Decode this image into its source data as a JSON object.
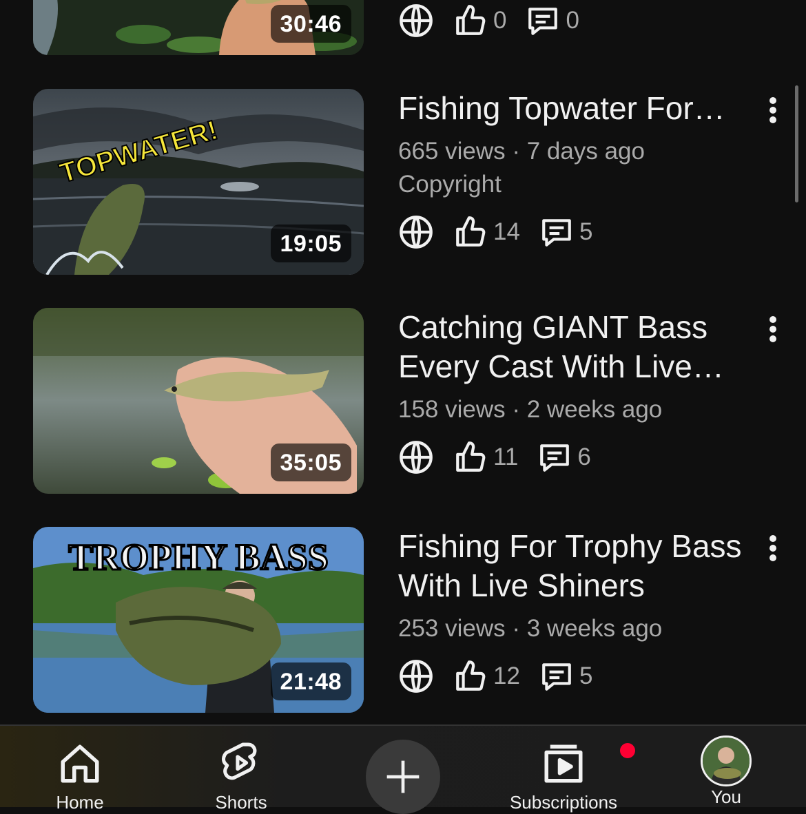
{
  "videos": [
    {
      "duration": "30:46",
      "visibility_icon": "globe-icon",
      "likes": "0",
      "comments": "0"
    },
    {
      "title": "Fishing Topwater For…",
      "meta": "665 views · 7 days ago",
      "claim": "Copyright",
      "duration": "19:05",
      "thumb_text": "TOPWATER!",
      "likes": "14",
      "comments": "5"
    },
    {
      "title": "Catching GIANT Bass Every Cast With Live…",
      "meta": "158 views · 2 weeks ago",
      "duration": "35:05",
      "likes": "11",
      "comments": "6"
    },
    {
      "title": "Fishing For Trophy Bass With Live Shiners",
      "meta": "253 views · 3 weeks ago",
      "duration": "21:48",
      "thumb_text": "TROPHY BASS",
      "likes": "12",
      "comments": "5"
    }
  ],
  "nav": {
    "home": "Home",
    "shorts": "Shorts",
    "create_icon": "plus-icon",
    "subscriptions": "Subscriptions",
    "you": "You",
    "notification_color": "#ff0033"
  },
  "colors": {
    "background": "#0f0f0f",
    "text": "#f1f1f1",
    "secondary": "#aaaaaa"
  }
}
